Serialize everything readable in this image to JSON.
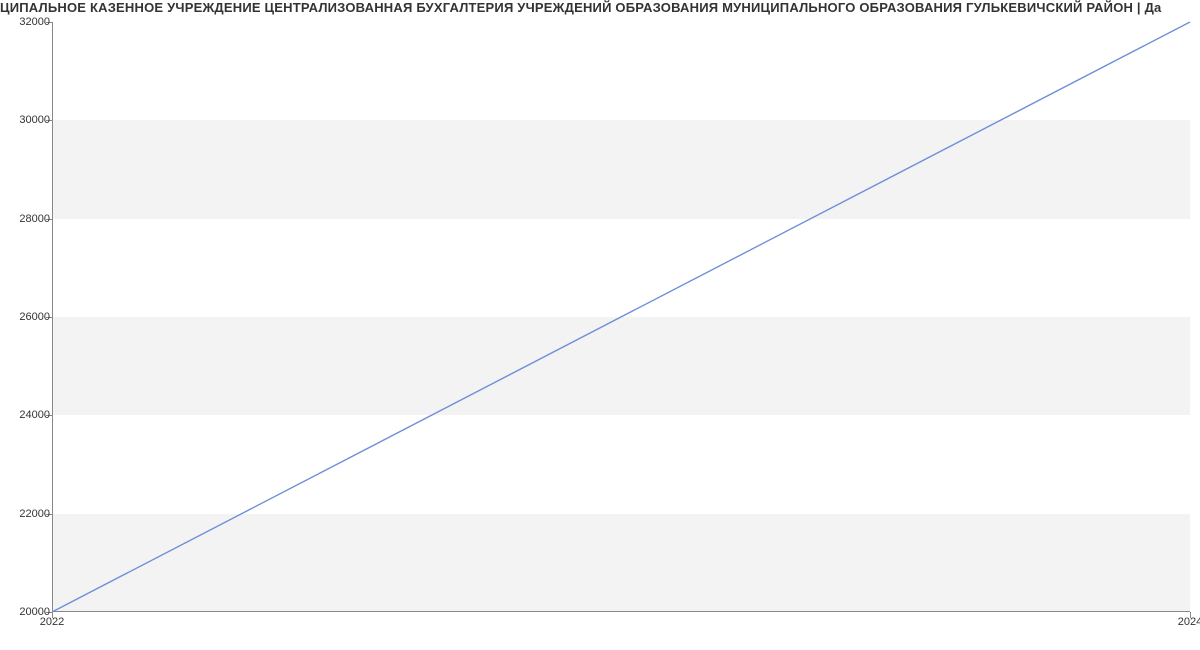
{
  "chart_data": {
    "type": "line",
    "title": "ЦИПАЛЬНОЕ КАЗЕННОЕ УЧРЕЖДЕНИЕ ЦЕНТРАЛИЗОВАННАЯ БУХГАЛТЕРИЯ УЧРЕЖДЕНИЙ ОБРАЗОВАНИЯ МУНИЦИПАЛЬНОГО ОБРАЗОВАНИЯ ГУЛЬКЕВИЧСКИЙ РАЙОН | Да",
    "x": [
      2022,
      2024
    ],
    "values": [
      20000,
      32000
    ],
    "x_ticks": [
      2022,
      2024
    ],
    "y_ticks": [
      20000,
      22000,
      24000,
      26000,
      28000,
      30000,
      32000
    ],
    "xlim": [
      2022,
      2024
    ],
    "ylim": [
      20000,
      32000
    ],
    "line_color": "#6f8fd9",
    "band_color": "#f3f3f3",
    "xlabel": "",
    "ylabel": ""
  }
}
